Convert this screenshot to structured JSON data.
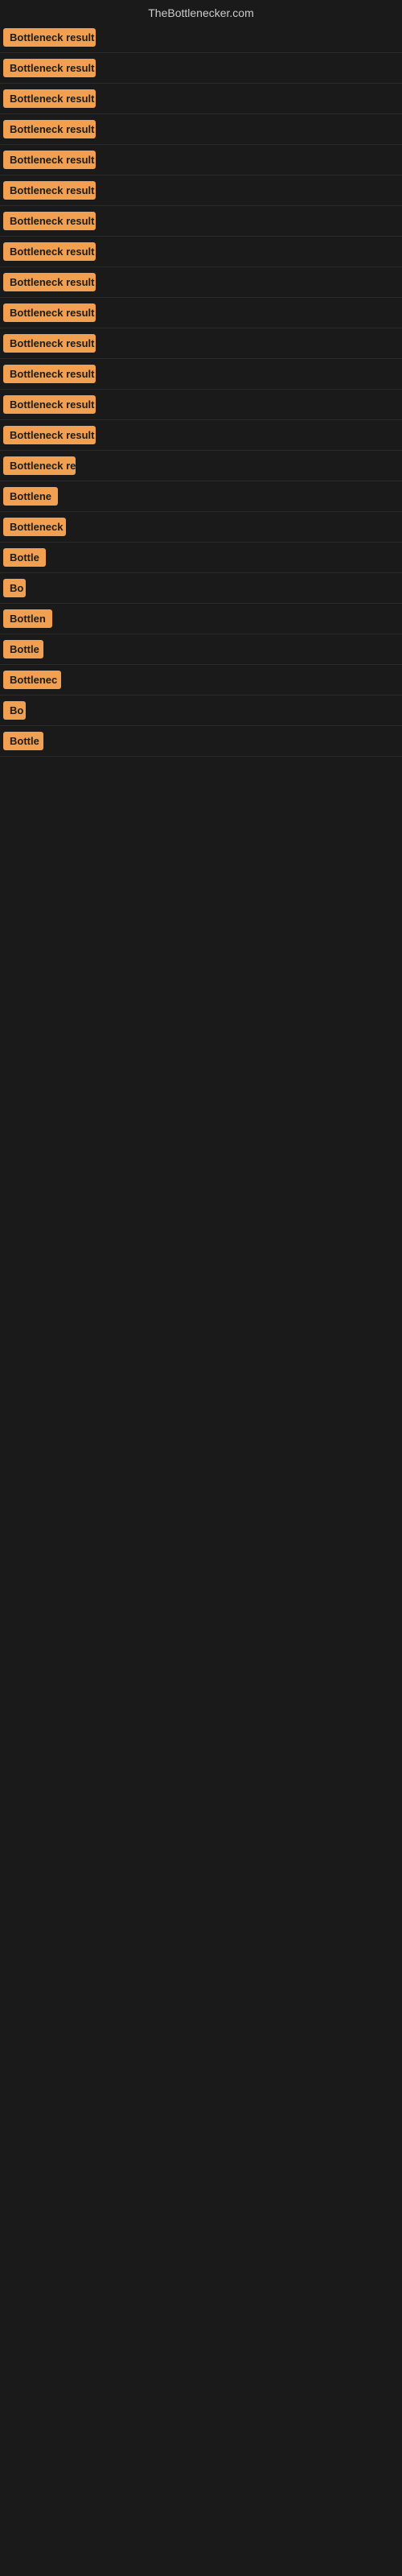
{
  "site": {
    "title": "TheBottlenecker.com"
  },
  "colors": {
    "badge_bg": "#f0a050",
    "page_bg": "#1a1a1a",
    "text_color": "#cccccc"
  },
  "rows": [
    {
      "id": 1,
      "label": "Bottleneck result",
      "width": 115
    },
    {
      "id": 2,
      "label": "Bottleneck result",
      "width": 115
    },
    {
      "id": 3,
      "label": "Bottleneck result",
      "width": 115
    },
    {
      "id": 4,
      "label": "Bottleneck result",
      "width": 115
    },
    {
      "id": 5,
      "label": "Bottleneck result",
      "width": 115
    },
    {
      "id": 6,
      "label": "Bottleneck result",
      "width": 115
    },
    {
      "id": 7,
      "label": "Bottleneck result",
      "width": 115
    },
    {
      "id": 8,
      "label": "Bottleneck result",
      "width": 115
    },
    {
      "id": 9,
      "label": "Bottleneck result",
      "width": 115
    },
    {
      "id": 10,
      "label": "Bottleneck result",
      "width": 115
    },
    {
      "id": 11,
      "label": "Bottleneck result",
      "width": 115
    },
    {
      "id": 12,
      "label": "Bottleneck result",
      "width": 115
    },
    {
      "id": 13,
      "label": "Bottleneck result",
      "width": 115
    },
    {
      "id": 14,
      "label": "Bottleneck result",
      "width": 115
    },
    {
      "id": 15,
      "label": "Bottleneck re",
      "width": 90
    },
    {
      "id": 16,
      "label": "Bottlene",
      "width": 70
    },
    {
      "id": 17,
      "label": "Bottleneck",
      "width": 78
    },
    {
      "id": 18,
      "label": "Bottle",
      "width": 55
    },
    {
      "id": 19,
      "label": "Bo",
      "width": 28
    },
    {
      "id": 20,
      "label": "Bottlen",
      "width": 62
    },
    {
      "id": 21,
      "label": "Bottle",
      "width": 50
    },
    {
      "id": 22,
      "label": "Bottlenec",
      "width": 72
    },
    {
      "id": 23,
      "label": "Bo",
      "width": 28
    },
    {
      "id": 24,
      "label": "Bottle",
      "width": 50
    }
  ]
}
